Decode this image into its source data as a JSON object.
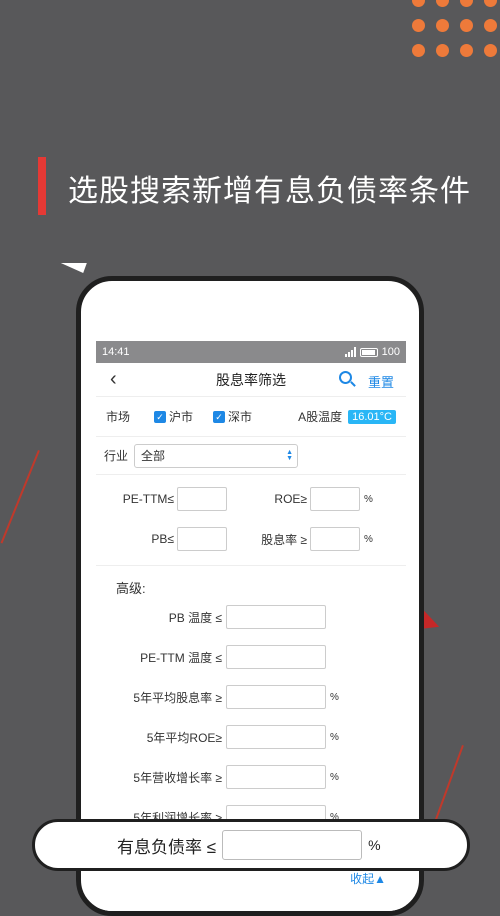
{
  "headline": "选股搜索新增有息负债率条件",
  "status": {
    "time": "14:41",
    "signal": "4G",
    "battery": "100"
  },
  "nav": {
    "title": "股息率筛选",
    "reset": "重置"
  },
  "market": {
    "label": "市场",
    "sh": "沪市",
    "sz": "深市",
    "temp_label": "A股温度",
    "temp_value": "16.01°C"
  },
  "industry": {
    "label": "行业",
    "value": "全部"
  },
  "basic": {
    "pe": "PE-TTM≤",
    "roe": "ROE≥",
    "pb": "PB≤",
    "dy": "股息率 ≥",
    "pct": "%"
  },
  "advanced": {
    "title": "高级:",
    "rows": [
      {
        "label": "PB 温度 ≤",
        "pct": ""
      },
      {
        "label": "PE-TTM 温度 ≤",
        "pct": ""
      },
      {
        "label": "5年平均股息率 ≥",
        "pct": "%"
      },
      {
        "label": "5年平均ROE≥",
        "pct": "%"
      },
      {
        "label": "5年营收增长率 ≥",
        "pct": "%"
      },
      {
        "label": "5年利润增长率 ≥",
        "pct": "%"
      }
    ],
    "collapse": "收起▲"
  },
  "overlay": {
    "label": "有息负债率 ≤",
    "pct": "%"
  },
  "colors": {
    "accent": "#1e88e5",
    "brand_red": "#e53935",
    "dot_orange": "#ee7a3a",
    "background": "#58585a"
  }
}
